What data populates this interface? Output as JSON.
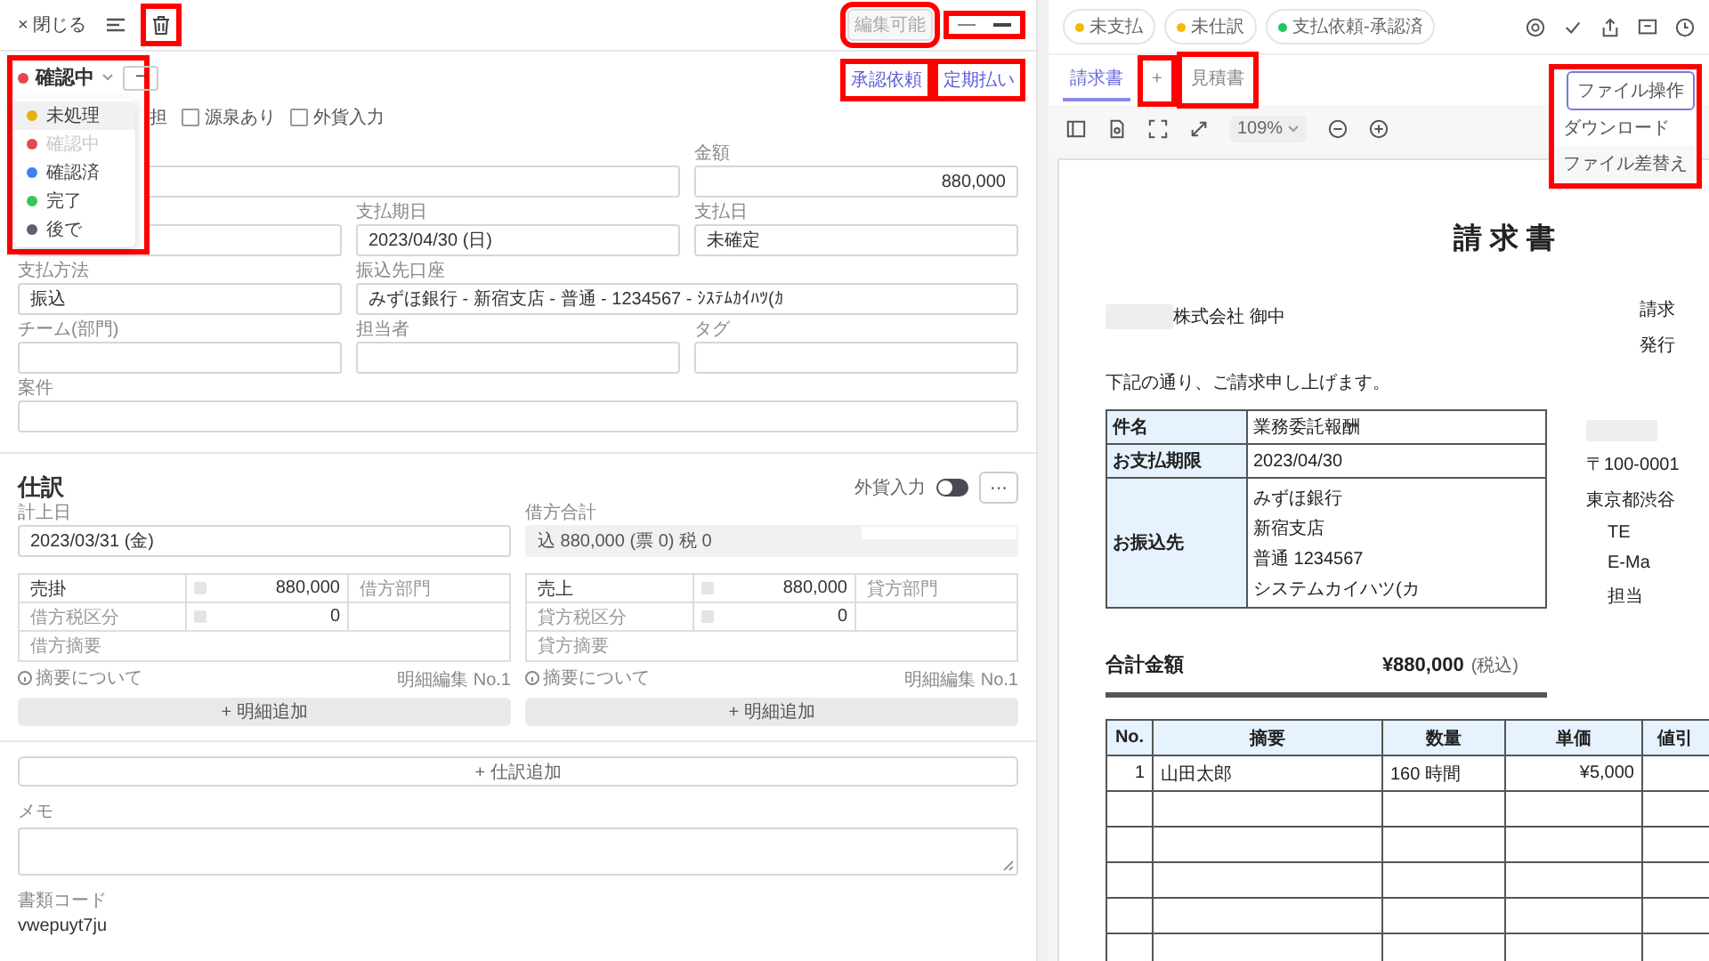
{
  "toolbar": {
    "close_icon": "×",
    "close_label": "閉じる",
    "trash_highlighted": true,
    "badge": "編集可能",
    "badge_highlighted": true,
    "nav_highlighted": true
  },
  "status": {
    "label": "確認中",
    "color": "#e5484d",
    "minus": "−",
    "menu_highlighted": true,
    "options": [
      {
        "label": "未処理",
        "color": "#e8b10e",
        "selected": false,
        "hovered": true
      },
      {
        "label": "確認中",
        "color": "#e5484d",
        "selected": true,
        "hovered": false
      },
      {
        "label": "確認済",
        "color": "#3b82f6",
        "selected": false,
        "hovered": false
      },
      {
        "label": "完了",
        "color": "#34c759",
        "selected": false,
        "hovered": false
      },
      {
        "label": "後で",
        "color": "#5b6270",
        "selected": false,
        "hovered": false
      }
    ]
  },
  "links": [
    {
      "label": "承認依頼",
      "highlighted": true
    },
    {
      "label": "定期払い",
      "highlighted": true
    }
  ],
  "checkboxes": {
    "leading_text": "担",
    "items": [
      {
        "label": "源泉あり",
        "checked": false
      },
      {
        "label": "外貨入力",
        "checked": false
      }
    ]
  },
  "form_rows": [
    [
      {
        "kind": "double"
      },
      {
        "label": "金額",
        "value": "880,000",
        "kind": "amount"
      }
    ],
    [
      {
        "kind": "single"
      },
      {
        "label": "支払期日",
        "value": "2023/04/30 (日)",
        "kind": "single"
      },
      {
        "label": "支払日",
        "value": "未確定",
        "kind": "single"
      }
    ],
    [
      {
        "label": "支払方法",
        "value": "振込",
        "kind": "single"
      },
      {
        "label": "振込先口座",
        "value": "みずほ銀行 - 新宿支店 - 普通 - 1234567 - ｼｽﾃﾑｶｲﾊﾂ(ｶ",
        "kind": "double"
      }
    ],
    [
      {
        "label": "チーム(部門)",
        "kind": "single"
      },
      {
        "label": "担当者",
        "kind": "single"
      },
      {
        "label": "タグ",
        "kind": "single"
      }
    ],
    [
      {
        "label": "案件",
        "kind": "full"
      }
    ]
  ],
  "journal": {
    "title": "仕訳",
    "fx_label": "外貨入力",
    "fx_on": false,
    "more": "···",
    "date_label": "計上日",
    "date_value": "2023/03/31 (金)",
    "total_label": "借方合計",
    "total_value": "込 880,000 (票 0)  税 0",
    "sides": [
      {
        "account": "売掛",
        "amount": "880,000",
        "dept_placeholder": "借方部門",
        "tax_placeholder": "借方税区分",
        "tax_amount": "0",
        "memo_placeholder": "借方摘要",
        "info": "摘要について",
        "edit": "明細編集",
        "no": "No.1",
        "add": "+ 明細追加"
      },
      {
        "account": "売上",
        "amount": "880,000",
        "dept_placeholder": "貸方部門",
        "tax_placeholder": "貸方税区分",
        "tax_amount": "0",
        "memo_placeholder": "貸方摘要",
        "info": "摘要について",
        "edit": "明細編集",
        "no": "No.1",
        "add": "+ 明細追加"
      }
    ],
    "add_entry": "+ 仕訳追加",
    "memo_label": "メモ",
    "code_label": "書類コード",
    "code_value": "vwepuyt7ju"
  },
  "tags": [
    {
      "label": "未支払",
      "color": "#f5b800"
    },
    {
      "label": "未仕訳",
      "color": "#f5b800"
    },
    {
      "label": "支払依頼-承認済",
      "color": "#22c55e"
    }
  ],
  "doc_tabs": [
    {
      "label": "請求書",
      "selected": true,
      "highlighted": false
    },
    {
      "label": "+",
      "selected": false,
      "highlighted": true
    },
    {
      "label": "見積書",
      "selected": false,
      "highlighted": true
    }
  ],
  "file_menu": {
    "button": "ファイル操作",
    "highlighted": true,
    "items": [
      "ダウンロード",
      "ファイル差替え"
    ]
  },
  "zoom": "109%",
  "invoice": {
    "title": "請 求 書",
    "recipient": "株式会社  御中",
    "meta": [
      "請求",
      "発行"
    ],
    "intro": "下記の通り、ご請求申し上げます。",
    "info_rows": [
      {
        "label": "件名",
        "lines": [
          "業務委託報酬"
        ]
      },
      {
        "label": "お支払期限",
        "lines": [
          "2023/04/30"
        ]
      },
      {
        "label": "お振込先",
        "lines": [
          "みずほ銀行",
          "新宿支店",
          "普通  1234567",
          "システムカイハツ(カ"
        ]
      }
    ],
    "issuer": [
      "〒100-0001",
      "東京都渋谷",
      "TE",
      "E-Ma",
      "担当"
    ],
    "total_label": "合計金額",
    "total_value": "¥880,000",
    "total_note": "(税込)",
    "columns": [
      "No.",
      "摘要",
      "数量",
      "単価",
      "値引"
    ],
    "rows": [
      [
        "1",
        "山田太郎",
        "160  時間",
        "¥5,000",
        ""
      ]
    ]
  }
}
